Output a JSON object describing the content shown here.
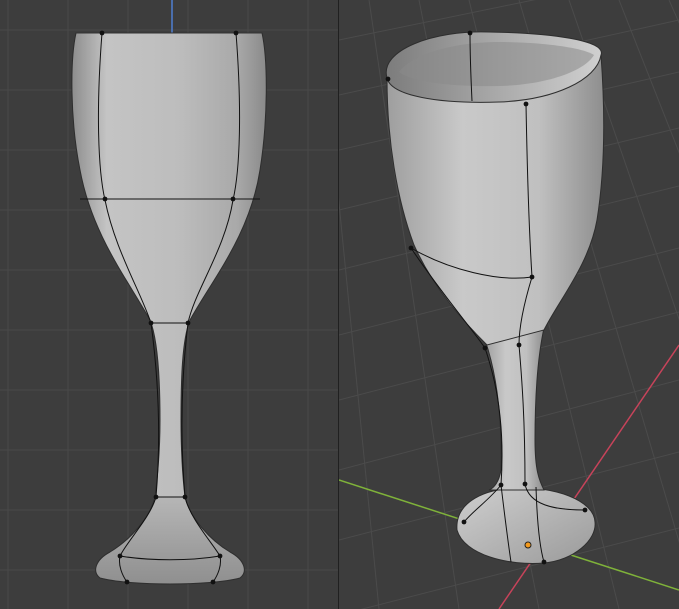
{
  "app": "Blender",
  "viewports": [
    {
      "name": "front-orthographic",
      "object": "wine-glass",
      "shading": "solid",
      "view": "front"
    },
    {
      "name": "user-perspective",
      "object": "wine-glass",
      "shading": "solid",
      "view": "perspective"
    }
  ],
  "colors": {
    "background": "#3d3d3d",
    "grid_line": "#4a4a4a",
    "axis_x": "#c7435a",
    "axis_y": "#7fb23a",
    "axis_z": "#4f7fd1",
    "mesh_fill": "#b8b8b8",
    "edge": "#111111",
    "origin": "#f39a1e"
  },
  "icons": {
    "object_origin": "origin-point-icon"
  }
}
